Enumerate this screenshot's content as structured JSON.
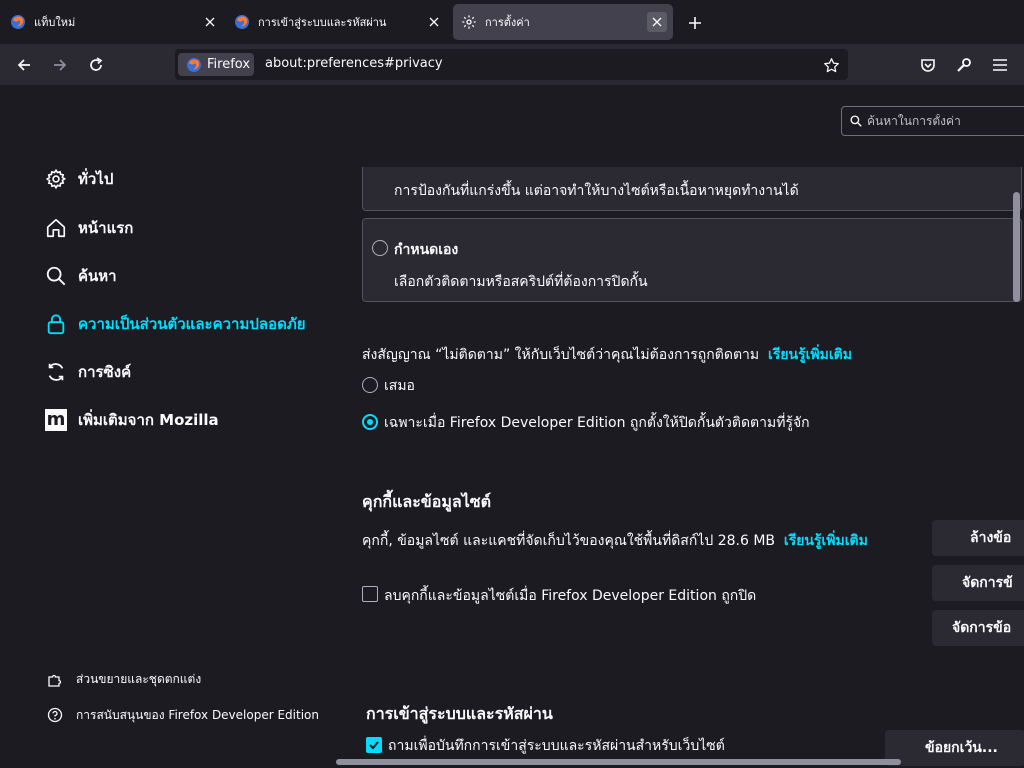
{
  "tabs": [
    {
      "label": "แท็บใหม่",
      "icon": "firefox-icon"
    },
    {
      "label": "การเข้าสู่ระบบและรหัสผ่าน",
      "icon": "firefox-icon"
    },
    {
      "label": "การตั้งค่า",
      "icon": "gear-icon"
    }
  ],
  "navbar": {
    "identity_label": "Firefox",
    "url": "about:preferences#privacy"
  },
  "search": {
    "placeholder": "ค้นหาในการตั้งค่า"
  },
  "sidebar": {
    "items": [
      {
        "label": "ทั่วไป",
        "icon": "gear-icon"
      },
      {
        "label": "หน้าแรก",
        "icon": "home-icon"
      },
      {
        "label": "ค้นหา",
        "icon": "search-icon"
      },
      {
        "label": "ความเป็นส่วนตัวและความปลอดภัย",
        "icon": "lock-icon"
      },
      {
        "label": "การซิงค์",
        "icon": "sync-icon"
      },
      {
        "label": "เพิ่มเติมจาก Mozilla",
        "icon": "mozilla-icon"
      }
    ],
    "mozilla_glyph": "m",
    "footer": [
      {
        "label": "ส่วนขยายและชุดตกแต่ง",
        "icon": "puzzle-icon"
      },
      {
        "label": "การสนับสนุนของ Firefox Developer Edition",
        "icon": "help-icon"
      }
    ]
  },
  "tracking": {
    "strict_desc": "การป้องกันที่แกร่งขึ้น แต่อาจทำให้บางไซต์หรือเนื้อหาหยุดทำงานได้",
    "custom_label": "กำหนดเอง",
    "custom_desc": "เลือกตัวติดตามหรือสคริปต์ที่ต้องการปิดกั้น"
  },
  "dnt": {
    "text": "ส่งสัญญาณ “ไม่ติดตาม” ให้กับเว็บไซต์ว่าคุณไม่ต้องการถูกติดตาม",
    "learn_more": "เรียนรู้เพิ่มเติม",
    "options": [
      {
        "label": "เสมอ",
        "selected": false
      },
      {
        "label": "เฉพาะเมื่อ Firefox Developer Edition ถูกตั้งให้ปิดกั้นตัวติดตามที่รู้จัก",
        "selected": true
      }
    ]
  },
  "cookies": {
    "heading": "คุกกี้และข้อมูลไซต์",
    "usage_text": "คุกกี้, ข้อมูลไซต์ และแคชที่จัดเก็บไว้ของคุณใช้พื้นที่ดิสก์ไป 28.6 MB",
    "learn_more": "เรียนรู้เพิ่มเติม",
    "delete_on_close_label": "ลบคุกกี้และข้อมูลไซต์เมื่อ Firefox Developer Edition ถูกปิด",
    "delete_on_close_checked": false,
    "buttons": [
      "ล้างข้อ",
      "จัดการข้",
      "จัดการข้อ"
    ]
  },
  "logins": {
    "heading": "การเข้าสู่ระบบและรหัสผ่าน",
    "ask_to_save_label": "ถามเพื่อบันทึกการเข้าสู่ระบบและรหัสผ่านสำหรับเว็บไซต์",
    "ask_to_save_checked": true,
    "exceptions_button": "ข้อยกเว้น..."
  },
  "colors": {
    "accent": "#00ddff",
    "background": "#1c1b22",
    "toolbar": "#2b2a33"
  }
}
